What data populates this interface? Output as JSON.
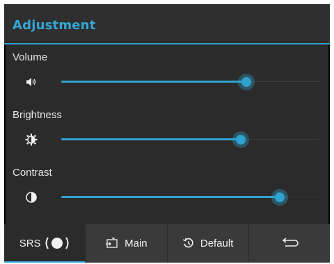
{
  "window": {
    "title": "Adjustment"
  },
  "settings": [
    {
      "label": "Volume",
      "icon": "speaker-icon",
      "level": 0.72
    },
    {
      "label": "Brightness",
      "icon": "brightness-icon",
      "level": 0.7
    },
    {
      "label": "Contrast",
      "icon": "contrast-icon",
      "level": 0.85
    }
  ],
  "bottom_bar": {
    "srs": {
      "label": "SRS",
      "icon": "toggle-switch-icon",
      "state": "on"
    },
    "main": {
      "label": "Main",
      "icon": "input-source-icon"
    },
    "default": {
      "label": "Default",
      "icon": "reset-icon"
    },
    "back": {
      "icon": "back-arrow-icon"
    }
  },
  "colors": {
    "accent": "#2fa3cf",
    "background": "#2b2b2b",
    "bottom_bar": "#3a3a3a",
    "text": "#e6e6e6"
  }
}
